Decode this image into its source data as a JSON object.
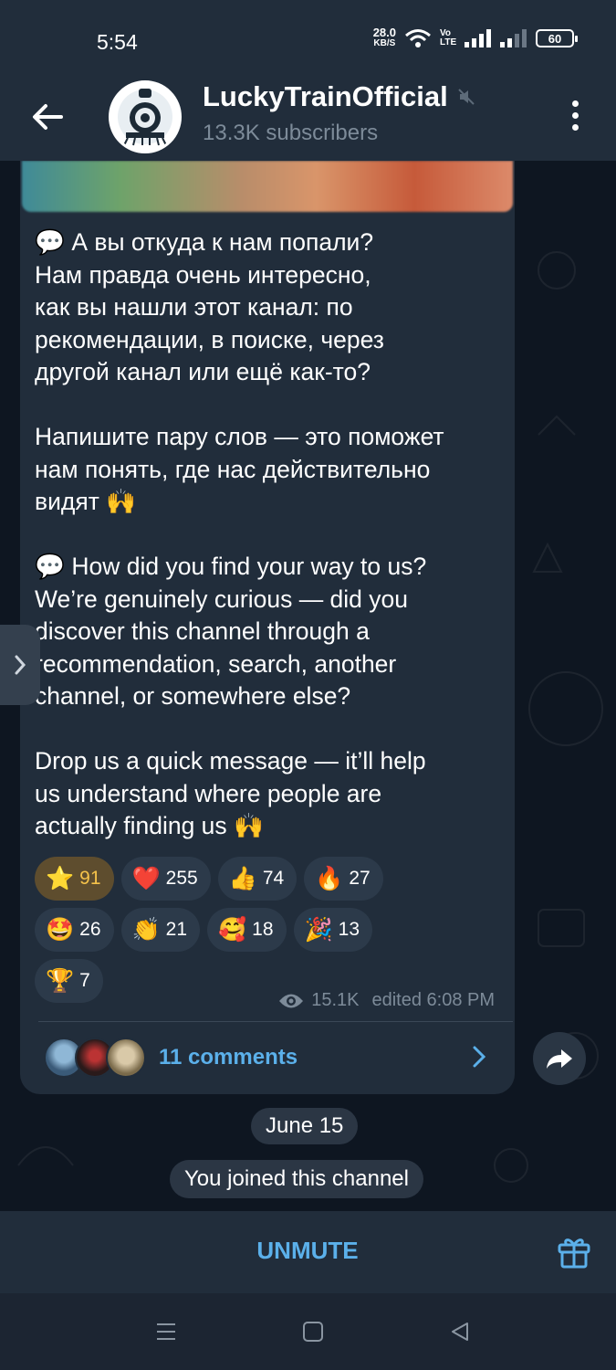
{
  "status_bar": {
    "time": "5:54",
    "net_speed_value": "28.0",
    "net_speed_unit": "KB/S",
    "volte": "Vo LTE",
    "battery": "60"
  },
  "header": {
    "title": "LuckyTrainOfficial",
    "subtitle": "13.3K subscribers"
  },
  "message": {
    "text": "💬 А вы откуда к нам попали?\nНам правда очень интересно,\nкак вы нашли этот канал: по\nрекомендации, в поиске, через\nдругой канал или ещё как-то?\n\nНапишите пару слов — это поможет\nнам понять, где нас действительно\nвидят 🙌\n\n💬 How did you find your way to us?\nWe’re genuinely curious — did you\ndiscover this channel through a\nrecommendation, search, another\nchannel, or somewhere else?\n\nDrop us a quick message — it’ll help\nus understand where people are\nactually finding us 🙌",
    "reactions": [
      {
        "emoji": "⭐",
        "count": "91",
        "active": true
      },
      {
        "emoji": "❤️",
        "count": "255"
      },
      {
        "emoji": "👍",
        "count": "74"
      },
      {
        "emoji": "🔥",
        "count": "27"
      },
      {
        "emoji": "🤩",
        "count": "26"
      },
      {
        "emoji": "👏",
        "count": "21"
      },
      {
        "emoji": "🥰",
        "count": "18"
      },
      {
        "emoji": "🎉",
        "count": "13"
      },
      {
        "emoji": "🏆",
        "count": "7"
      }
    ],
    "views": "15.1K",
    "edited": "edited 6:08 PM",
    "comments": "11 comments"
  },
  "service": {
    "date": "June 15",
    "joined": "You joined this channel"
  },
  "bottom": {
    "unmute": "UNMUTE"
  },
  "colors": {
    "accent": "#5bb0ea",
    "bubble": "#212d3b",
    "background": "#0e1621"
  }
}
